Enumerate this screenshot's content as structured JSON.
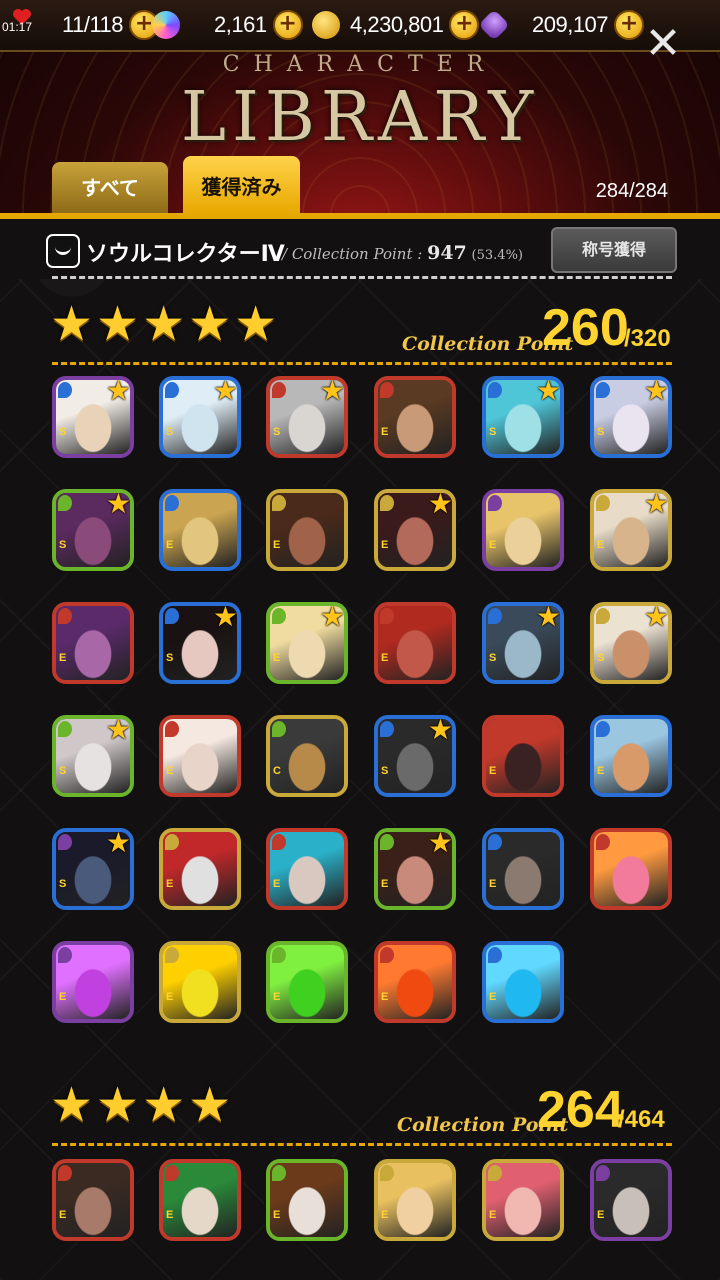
{
  "status": {
    "time": "01:17"
  },
  "resources": [
    {
      "id": "stamina",
      "value": "11/118"
    },
    {
      "id": "crystals",
      "value": "2,161"
    },
    {
      "id": "gold",
      "value": "4,230,801"
    },
    {
      "id": "gems",
      "value": "209,107"
    }
  ],
  "header": {
    "title_small": "CHARACTER",
    "title_big": "LIBRARY"
  },
  "tabs": {
    "all": "すべて",
    "owned": "獲得済み",
    "count": "284/284"
  },
  "collection": {
    "title": "ソウルコレクターⅣ",
    "point_label": "/ Collection Point :",
    "point_value": "947",
    "point_pct": "(53.4%)",
    "title_button": "称号獲得"
  },
  "sections": [
    {
      "stars": 5,
      "label": "Collection Point",
      "value": "260",
      "max": "/320"
    },
    {
      "stars": 4,
      "label": "Collection Point",
      "value": "264",
      "max": "/464"
    }
  ],
  "card_grid_5star": [
    {
      "border": "#7b3fa1",
      "rank": "S",
      "star": true,
      "face": "#e8d2b8",
      "hair": "#f2ece6",
      "attr": "#2a6fd6"
    },
    {
      "border": "#2a6fd6",
      "rank": "S",
      "star": true,
      "face": "#cfe4ef",
      "hair": "#dfeef6",
      "attr": "#2a6fd6"
    },
    {
      "border": "#c0392b",
      "rank": "S",
      "star": true,
      "face": "#d9d6d2",
      "hair": "#b8b8b8",
      "attr": "#c0392b"
    },
    {
      "border": "#c0392b",
      "rank": "E",
      "star": false,
      "face": "#c99a78",
      "hair": "#5a3a22",
      "attr": "#c0392b"
    },
    {
      "border": "#2a6fd6",
      "rank": "S",
      "star": true,
      "face": "#9fe0e6",
      "hair": "#4fc6d8",
      "attr": "#2a6fd6"
    },
    {
      "border": "#2a6fd6",
      "rank": "S",
      "star": true,
      "face": "#e9e4ef",
      "hair": "#c8cde3",
      "attr": "#2a6fd6"
    },
    {
      "border": "#6bb52a",
      "rank": "S",
      "star": true,
      "face": "#8a4a7a",
      "hair": "#5b2a5f",
      "attr": "#6bb52a"
    },
    {
      "border": "#2a6fd6",
      "rank": "E",
      "star": false,
      "face": "#e2c67d",
      "hair": "#caa450",
      "attr": "#2a6fd6"
    },
    {
      "border": "#c8a93a",
      "rank": "E",
      "star": false,
      "face": "#a0634a",
      "hair": "#4a2a1a",
      "attr": "#c8a93a"
    },
    {
      "border": "#c8a93a",
      "rank": "E",
      "star": true,
      "face": "#b36a5a",
      "hair": "#3a1a1a",
      "attr": "#c8a93a"
    },
    {
      "border": "#7b3fa1",
      "rank": "E",
      "star": false,
      "face": "#ecd09a",
      "hair": "#e7c36a",
      "attr": "#7b3fa1"
    },
    {
      "border": "#c8a93a",
      "rank": "E",
      "star": true,
      "face": "#d8b48c",
      "hair": "#e8dcc8",
      "attr": "#c8a93a"
    },
    {
      "border": "#c0392b",
      "rank": "E",
      "star": false,
      "face": "#a868a8",
      "hair": "#5a2a6a",
      "attr": "#c0392b"
    },
    {
      "border": "#2a6fd6",
      "rank": "S",
      "star": true,
      "face": "#e6c8c0",
      "hair": "#1a1212",
      "attr": "#2a6fd6"
    },
    {
      "border": "#6bb52a",
      "rank": "E",
      "star": true,
      "face": "#eedab0",
      "hair": "#f0dca0",
      "attr": "#6bb52a"
    },
    {
      "border": "#c0392b",
      "rank": "E",
      "star": false,
      "face": "#c2584a",
      "hair": "#b02a20",
      "attr": "#c0392b"
    },
    {
      "border": "#2a6fd6",
      "rank": "S",
      "star": true,
      "face": "#9ab8c8",
      "hair": "#3a4a5a",
      "attr": "#2a6fd6"
    },
    {
      "border": "#c8a93a",
      "rank": "S",
      "star": true,
      "face": "#c9906a",
      "hair": "#ece2d2",
      "attr": "#c8a93a"
    },
    {
      "border": "#6bb52a",
      "rank": "S",
      "star": true,
      "face": "#e6e2e2",
      "hair": "#d0c8c8",
      "attr": "#6bb52a"
    },
    {
      "border": "#c0392b",
      "rank": "E",
      "star": false,
      "face": "#e8d4c8",
      "hair": "#f4e8e0",
      "attr": "#c0392b"
    },
    {
      "border": "#c8a93a",
      "rank": "C",
      "star": false,
      "face": "#b88a4a",
      "hair": "#3a3a3a",
      "attr": "#6bb52a"
    },
    {
      "border": "#2a6fd6",
      "rank": "S",
      "star": true,
      "face": "#6a6a6a",
      "hair": "#2a2a2a",
      "attr": "#2a6fd6"
    },
    {
      "border": "#c0392b",
      "rank": "E",
      "star": false,
      "face": "#3a2222",
      "hair": "#c0392b",
      "attr": "#c0392b"
    },
    {
      "border": "#2a6fd6",
      "rank": "E",
      "star": false,
      "face": "#d89a68",
      "hair": "#9ac6e0",
      "attr": "#2a6fd6"
    },
    {
      "border": "#2a6fd6",
      "rank": "S",
      "star": true,
      "face": "#4a5a7a",
      "hair": "#1a1a2a",
      "attr": "#7b3fa1"
    },
    {
      "border": "#c8a93a",
      "rank": "E",
      "star": false,
      "face": "#e0e0e0",
      "hair": "#c0282a",
      "attr": "#c8a93a"
    },
    {
      "border": "#c0392b",
      "rank": "E",
      "star": false,
      "face": "#d8c8c0",
      "hair": "#2ab0c8",
      "attr": "#c0392b"
    },
    {
      "border": "#6bb52a",
      "rank": "E",
      "star": true,
      "face": "#c88a7a",
      "hair": "#3a2018",
      "attr": "#6bb52a"
    },
    {
      "border": "#2a6fd6",
      "rank": "E",
      "star": false,
      "face": "#8a7a70",
      "hair": "#2a2a2a",
      "attr": "#2a6fd6"
    },
    {
      "border": "#c0392b",
      "rank": "",
      "star": false,
      "face": "#f27a9a",
      "hair": "#ff9a40",
      "attr": "#c0392b"
    },
    {
      "border": "#7b3fa1",
      "rank": "E",
      "star": false,
      "face": "#c040e0",
      "hair": "#e070ff",
      "attr": "#7b3fa1"
    },
    {
      "border": "#c8a93a",
      "rank": "E",
      "star": false,
      "face": "#f0e020",
      "hair": "#ffd000",
      "attr": "#c8a93a"
    },
    {
      "border": "#6bb52a",
      "rank": "E",
      "star": false,
      "face": "#40d020",
      "hair": "#80f040",
      "attr": "#6bb52a"
    },
    {
      "border": "#c0392b",
      "rank": "E",
      "star": false,
      "face": "#f04a10",
      "hair": "#ff7a30",
      "attr": "#c0392b"
    },
    {
      "border": "#2a6fd6",
      "rank": "E",
      "star": false,
      "face": "#20b8f0",
      "hair": "#60d8ff",
      "attr": "#2a6fd6"
    }
  ],
  "card_grid_4star": [
    {
      "border": "#c0392b",
      "rank": "E",
      "star": false,
      "face": "#a87a6a",
      "hair": "#3a2a22",
      "attr": "#c0392b"
    },
    {
      "border": "#c0392b",
      "rank": "E",
      "star": false,
      "face": "#e6d8c8",
      "hair": "#2a8a3a",
      "attr": "#c0392b"
    },
    {
      "border": "#6bb52a",
      "rank": "E",
      "star": false,
      "face": "#e8e0d8",
      "hair": "#6a3a1a",
      "attr": "#6bb52a"
    },
    {
      "border": "#c8a93a",
      "rank": "E",
      "star": false,
      "face": "#f0d0a0",
      "hair": "#e8c060",
      "attr": "#c8a93a"
    },
    {
      "border": "#c8a93a",
      "rank": "E",
      "star": false,
      "face": "#f0b8b0",
      "hair": "#e06070",
      "attr": "#c8a93a"
    },
    {
      "border": "#7b3fa1",
      "rank": "E",
      "star": false,
      "face": "#c8c0b8",
      "hair": "#2a2a2a",
      "attr": "#7b3fa1"
    }
  ]
}
